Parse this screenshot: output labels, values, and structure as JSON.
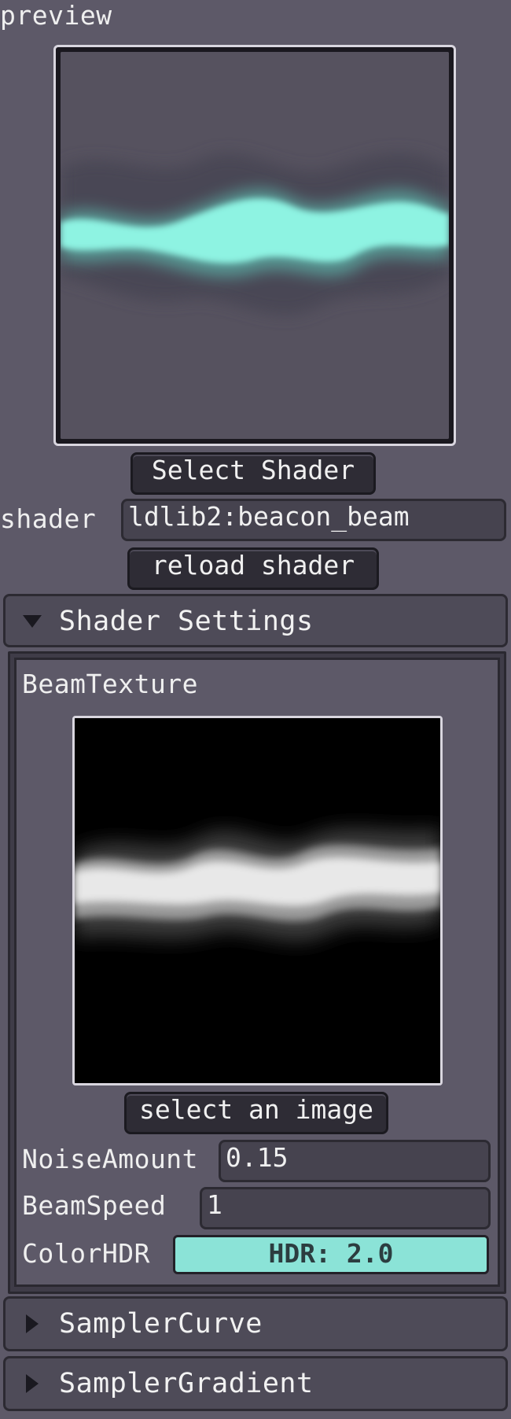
{
  "preview": {
    "label": "preview",
    "select_shader_label": "Select Shader",
    "shader_label": "shader",
    "shader_value": "ldlib2:beacon_beam",
    "reload_label": "reload shader"
  },
  "shader_settings": {
    "title": "Shader Settings",
    "beam_texture_label": "BeamTexture",
    "select_image_label": "select an image",
    "noise_amount_label": "NoiseAmount",
    "noise_amount_value": "0.15",
    "beam_speed_label": "BeamSpeed",
    "beam_speed_value": "1",
    "color_hdr_label": "ColorHDR",
    "color_hdr_value": "HDR: 2.0",
    "color_hdr_color": "#8be3d7"
  },
  "sections": {
    "sampler_curve_title": "SamplerCurve",
    "sampler_gradient_title": "SamplerGradient"
  },
  "icons": {
    "expanded": "triangle-down-icon",
    "collapsed": "triangle-right-icon"
  }
}
